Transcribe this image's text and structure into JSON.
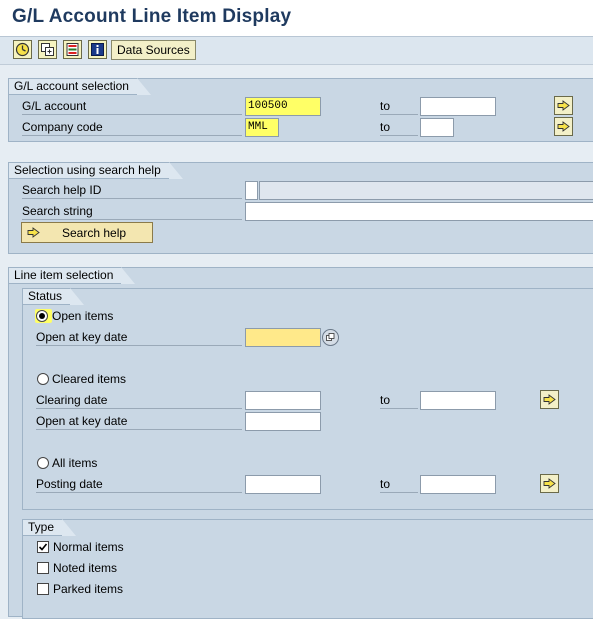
{
  "window": {
    "title": "G/L Account Line Item Display"
  },
  "toolbar": {
    "execute_icon": "clock-execute-icon",
    "get_variant_icon": "copy-variant-icon",
    "selection_options_icon": "selection-options-icon",
    "info_icon": "info-icon",
    "data_sources_label": "Data Sources"
  },
  "gl_selection": {
    "title": "G/L account selection",
    "gl_account_label": "G/L account",
    "gl_account_value": "100500",
    "gl_account_to_label": "to",
    "gl_account_to_value": "",
    "company_code_label": "Company code",
    "company_code_value": "MML",
    "company_code_to_label": "to",
    "company_code_to_value": ""
  },
  "search_help": {
    "title": "Selection using search help",
    "id_label": "Search help ID",
    "id_value": "",
    "string_label": "Search string",
    "string_value": "",
    "button_label": "Search help"
  },
  "line_item": {
    "title": "Line item selection",
    "status": {
      "title": "Status",
      "open_items_label": "Open items",
      "open_key_date_label": "Open at key date",
      "open_key_date_value": "",
      "cleared_items_label": "Cleared items",
      "clearing_date_label": "Clearing date",
      "clearing_date_value": "",
      "clearing_to_label": "to",
      "clearing_to_value": "",
      "cleared_key_date_label": "Open at key date",
      "cleared_key_date_value": "",
      "all_items_label": "All items",
      "posting_date_label": "Posting date",
      "posting_date_value": "",
      "posting_to_label": "to",
      "posting_to_value": "",
      "selected": "open_items"
    },
    "type": {
      "title": "Type",
      "normal_items_label": "Normal items",
      "normal_items_checked": true,
      "noted_items_label": "Noted items",
      "noted_items_checked": false,
      "parked_items_label": "Parked items",
      "parked_items_checked": false
    }
  },
  "colors": {
    "accent_title": "#1f3a5f",
    "group_bg": "#c9d7e4",
    "highlight": "#ffff66"
  }
}
